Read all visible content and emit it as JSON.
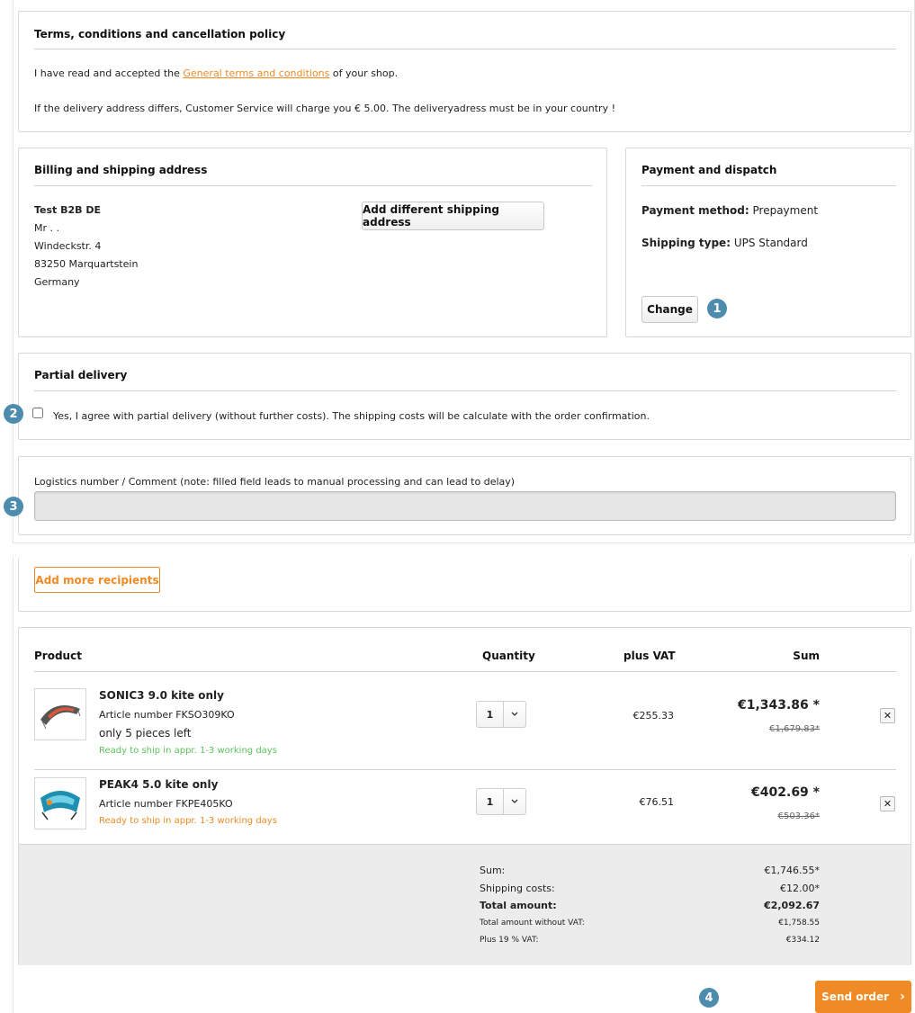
{
  "terms": {
    "title": "Terms, conditions and cancellation policy",
    "accept_prefix": "I have read and accepted the ",
    "accept_link": "General terms and conditions",
    "accept_suffix": " of your shop.",
    "note": "If the delivery address differs, Customer Service will charge you € 5.00. The deliveryadress must be in your country !"
  },
  "billing": {
    "title": "Billing and shipping address",
    "company": "Test B2B DE",
    "salutation": "Mr . .",
    "street": "Windeckstr. 4",
    "city": "83250 Marquartstein",
    "country": "Germany",
    "add_shipping_label": "Add different shipping address"
  },
  "payment": {
    "title": "Payment and dispatch",
    "method_label": "Payment method:",
    "method_value": " Prepayment",
    "shipping_label": "Shipping type:",
    "shipping_value": " UPS Standard",
    "change_label": "Change"
  },
  "partial": {
    "title": "Partial delivery",
    "checkbox_label": "Yes, I agree with partial delivery (without further costs). The shipping costs will be calculate with the order confirmation.",
    "checked": false
  },
  "comment": {
    "label": "Logistics number / Comment (note: filled field leads to manual processing and can lead to delay)",
    "value": ""
  },
  "recipients": {
    "add_label": "Add more recipients"
  },
  "table": {
    "headers": {
      "product": "Product",
      "quantity": "Quantity",
      "vat": "plus VAT",
      "sum": "Sum"
    },
    "rows": [
      {
        "name": "SONIC3 9.0 kite only",
        "article": "Article number FKSO309KO",
        "stock": "only 5 pieces left",
        "availability": "Ready to ship in appr. 1-3 working days",
        "availability_color": "#5cc25c",
        "qty": "1",
        "vat": "€255.33",
        "price": "€1,343.86 *",
        "old_price": "€1,679.83*",
        "remove": "✕"
      },
      {
        "name": "PEAK4 5.0 kite only",
        "article": "Article number FKPE405KO",
        "stock": "",
        "availability": "Ready to ship in appr. 1-3 working days",
        "availability_color": "#f08a24",
        "qty": "1",
        "vat": "€76.51",
        "price": "€402.69 *",
        "old_price": "€503.36*",
        "remove": "✕"
      }
    ]
  },
  "totals": {
    "sum_label": "Sum:",
    "sum_value": "€1,746.55*",
    "shipping_label": "Shipping costs:",
    "shipping_value": "€12.00*",
    "total_label": "Total amount:",
    "total_value": "€2,092.67",
    "net_label": "Total amount without VAT:",
    "net_value": "€1,758.55",
    "vat_label": "Plus 19 % VAT:",
    "vat_value": "€334.12"
  },
  "send_order": {
    "label": "Send order",
    "chevron": "›"
  },
  "badges": {
    "b1": "1",
    "b2": "2",
    "b3": "3",
    "b4": "4"
  },
  "colors": {
    "accent": "#f08a24",
    "badge": "#4d8cad",
    "ready_green": "#5cc25c"
  }
}
